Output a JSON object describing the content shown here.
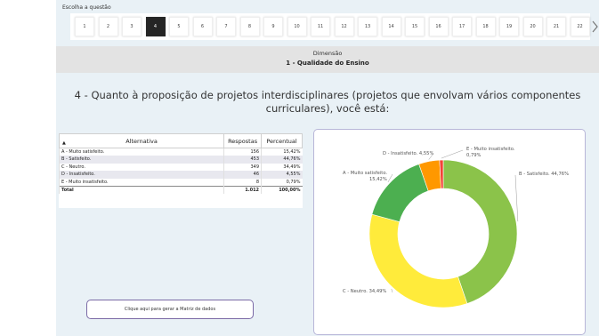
{
  "selector": {
    "title": "Escolha a questão",
    "questions": [
      "1",
      "2",
      "3",
      "4",
      "5",
      "6",
      "7",
      "8",
      "9",
      "10",
      "11",
      "12",
      "13",
      "14",
      "15",
      "16",
      "17",
      "18",
      "19",
      "20",
      "21",
      "22"
    ],
    "active": "4"
  },
  "dimension": {
    "label": "Dimensão",
    "value": "1 - Qualidade do Ensino"
  },
  "question": {
    "text": "4 - Quanto à proposição de projetos interdisciplinares (projetos que envolvam vários componentes curriculares), você está:"
  },
  "table": {
    "headers": {
      "alt": "Alternativa",
      "resp": "Respostas",
      "perc": "Percentual"
    },
    "rows": [
      {
        "alt": "A - Muito satisfeito.",
        "resp": "156",
        "perc": "15,42%"
      },
      {
        "alt": "B - Satisfeito.",
        "resp": "453",
        "perc": "44,76%"
      },
      {
        "alt": "C - Neutro.",
        "resp": "349",
        "perc": "34,49%"
      },
      {
        "alt": "D - Insatisfeito.",
        "resp": "46",
        "perc": "4,55%"
      },
      {
        "alt": "E - Muito insatisfeito.",
        "resp": "8",
        "perc": "0,79%"
      }
    ],
    "total": {
      "alt": "Total",
      "resp": "1.012",
      "perc": "100,00%"
    }
  },
  "matrix_button": {
    "label": "Clique aqui para gerar a Matriz de dados"
  },
  "chart_data": {
    "type": "pie",
    "donut": true,
    "slices": [
      {
        "label": "B - Satisfeito. 44,76%",
        "value": 44.76,
        "color": "#8bc34a"
      },
      {
        "label": "C - Neutro. 34,49%",
        "value": 34.49,
        "color": "#ffeb3b"
      },
      {
        "label": "A - Muito satisfeito. 15,42%",
        "value": 15.42,
        "color": "#4caf50"
      },
      {
        "label": "D - Insatisfeito. 4,55%",
        "value": 4.55,
        "color": "#ff9800"
      },
      {
        "label": "E - Muito insatisfeito. 0,79%",
        "value": 0.79,
        "color": "#f44336"
      }
    ]
  }
}
